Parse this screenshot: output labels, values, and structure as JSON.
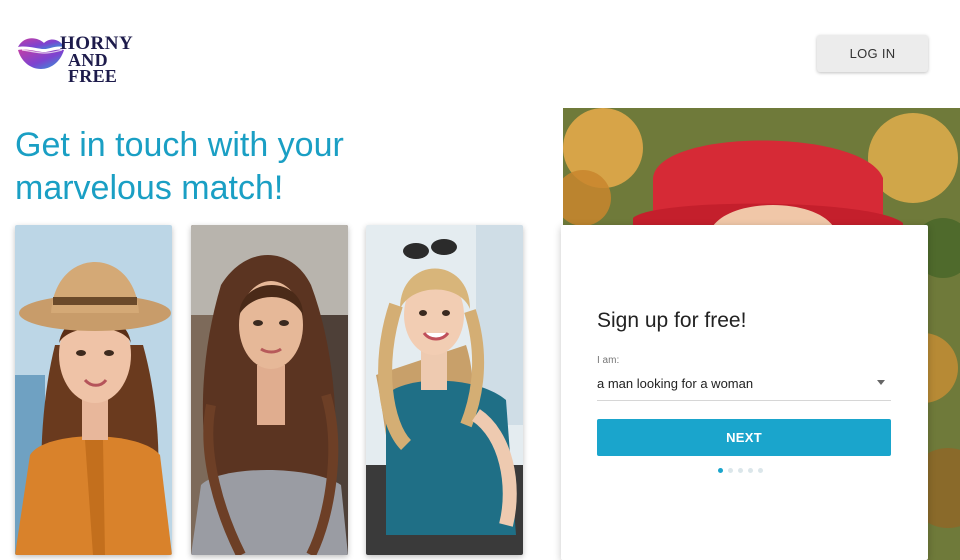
{
  "brand": {
    "line1": "HORNY",
    "line2": "AND FREE"
  },
  "header": {
    "login_label": "LOG IN"
  },
  "hero": {
    "headline": "Get in touch with your marvelous match!"
  },
  "signup": {
    "title": "Sign up for free!",
    "field_label": "I am:",
    "field_value": "a man looking for a woman",
    "next_label": "NEXT",
    "steps_total": 5,
    "step_current": 1
  },
  "colors": {
    "accent": "#1aa5cc",
    "headline": "#1a9fc4",
    "brand_dark": "#1d1b4b",
    "brand_purple": "#8e3fc7"
  }
}
